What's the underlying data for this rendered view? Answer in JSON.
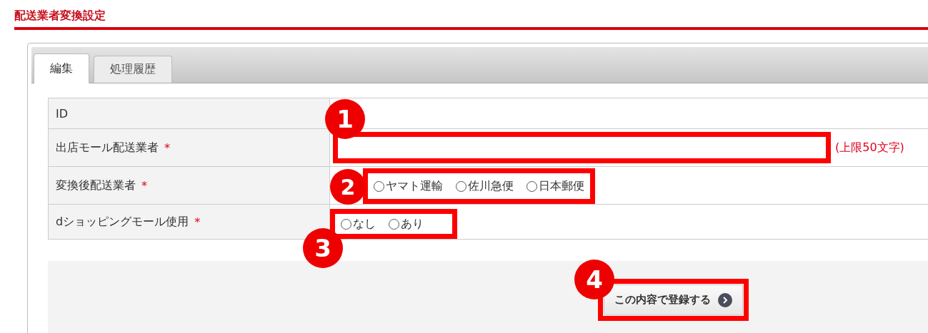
{
  "page_title": "配送業者変換設定",
  "tabs": [
    {
      "label": "編集",
      "selected": true
    },
    {
      "label": "処理履歴",
      "selected": false
    }
  ],
  "form_rows": [
    {
      "kind": "plain",
      "label": "ID"
    },
    {
      "kind": "text",
      "label": "出店モール配送業者",
      "required_mark": "*",
      "note": "(上限50文字)",
      "callout": "1"
    },
    {
      "kind": "radio",
      "label": "変換後配送業者",
      "required_mark": "*",
      "callout": "2",
      "options": [
        {
          "label": "ヤマト運輸",
          "selected": false
        },
        {
          "label": "佐川急便",
          "selected": false
        },
        {
          "label": "日本郵便",
          "selected": false
        }
      ]
    },
    {
      "kind": "radio",
      "label": "dショッピングモール使用",
      "required_mark": "*",
      "callout": "3",
      "options": [
        {
          "label": "なし",
          "selected": false
        },
        {
          "label": "あり",
          "selected": false
        }
      ]
    }
  ],
  "submit_button": {
    "label": "この内容で登録する",
    "callout": "4"
  }
}
